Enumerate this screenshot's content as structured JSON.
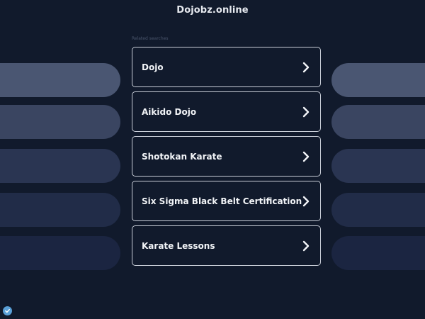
{
  "header": {
    "site_name": "Dojobz.online"
  },
  "related": {
    "label": "Related searches",
    "items": [
      {
        "label": "Dojo"
      },
      {
        "label": "Aikido Dojo"
      },
      {
        "label": "Shotokan Karate"
      },
      {
        "label": "Six Sigma Black Belt Certification"
      },
      {
        "label": "Karate Lessons"
      }
    ]
  },
  "icons": {
    "chevron": "chevron-right-icon",
    "privacy": "privacy-shield-icon"
  },
  "colors": {
    "background": "#111a2c",
    "item_border": "#c9ced8",
    "text": "#f2f4f7"
  }
}
